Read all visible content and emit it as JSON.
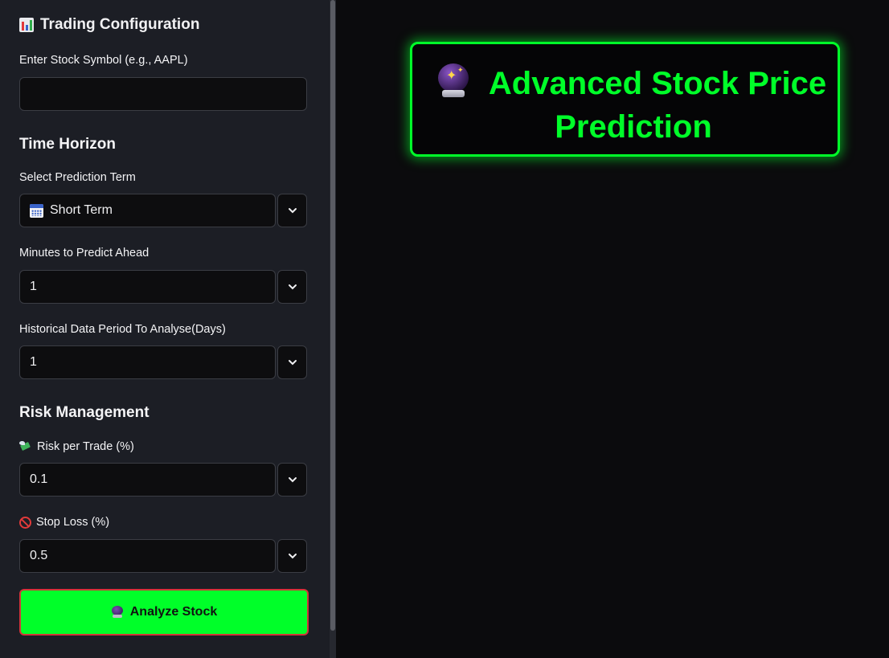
{
  "sidebar": {
    "title": "Trading Configuration",
    "title_icon": "bar-chart-icon",
    "symbol": {
      "label": "Enter Stock Symbol (e.g., AAPL)",
      "value": ""
    },
    "time_horizon_heading": "Time Horizon",
    "prediction_term": {
      "label": "Select Prediction Term",
      "value": "Short Term",
      "icon": "calendar-icon"
    },
    "minutes_ahead": {
      "label": "Minutes to Predict Ahead",
      "value": "1"
    },
    "history_days": {
      "label": "Historical Data Period To Analyse(Days)",
      "value": "1"
    },
    "risk_heading": "Risk Management",
    "risk_per_trade": {
      "label": "Risk per Trade (%)",
      "value": "0.1",
      "icon": "money-wings-icon"
    },
    "stop_loss": {
      "label": "Stop Loss (%)",
      "value": "0.5",
      "icon": "no-entry-icon"
    },
    "analyze_button": "Analyze Stock"
  },
  "main": {
    "title_line1": "Advanced Stock Price",
    "title_line2": "Prediction",
    "title_icon": "crystal-ball-icon"
  },
  "colors": {
    "accent": "#00ff29",
    "sidebar_bg": "#1c1e25",
    "main_bg": "#0b0b0d",
    "button_border": "#d3343a"
  }
}
